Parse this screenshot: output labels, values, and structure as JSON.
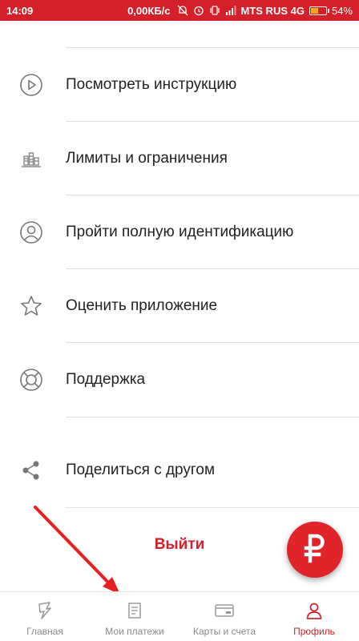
{
  "status_bar": {
    "time": "14:09",
    "speed": "0,00КБ/с",
    "carrier": "MTS RUS 4G",
    "battery": "54%",
    "battery_level": 0.54
  },
  "menu": {
    "items": [
      {
        "label": "Посмотреть инструкцию",
        "icon": "play-circle-icon"
      },
      {
        "label": "Лимиты и ограничения",
        "icon": "coin-stacks-icon"
      },
      {
        "label": "Пройти полную идентификацию",
        "icon": "user-circle-icon"
      },
      {
        "label": "Оценить приложение",
        "icon": "star-icon"
      },
      {
        "label": "Поддержка",
        "icon": "lifebuoy-icon"
      },
      {
        "label": "Поделиться с другом",
        "icon": "share-icon"
      }
    ]
  },
  "logout_label": "Выйти",
  "fab": {
    "symbol": "₽",
    "icon": "ruble-icon"
  },
  "bottom_nav": {
    "items": [
      {
        "label": "Главная",
        "icon": "home-logo-icon",
        "active": false
      },
      {
        "label": "Мои платежи",
        "icon": "document-icon",
        "active": false
      },
      {
        "label": "Карты и счета",
        "icon": "card-icon",
        "active": false
      },
      {
        "label": "Профиль",
        "icon": "user-icon",
        "active": true
      }
    ]
  },
  "colors": {
    "accent": "#d3202a",
    "divider": "#dedede",
    "text": "#222222",
    "muted": "#8a8a8a",
    "arrow": "#e8201f"
  }
}
